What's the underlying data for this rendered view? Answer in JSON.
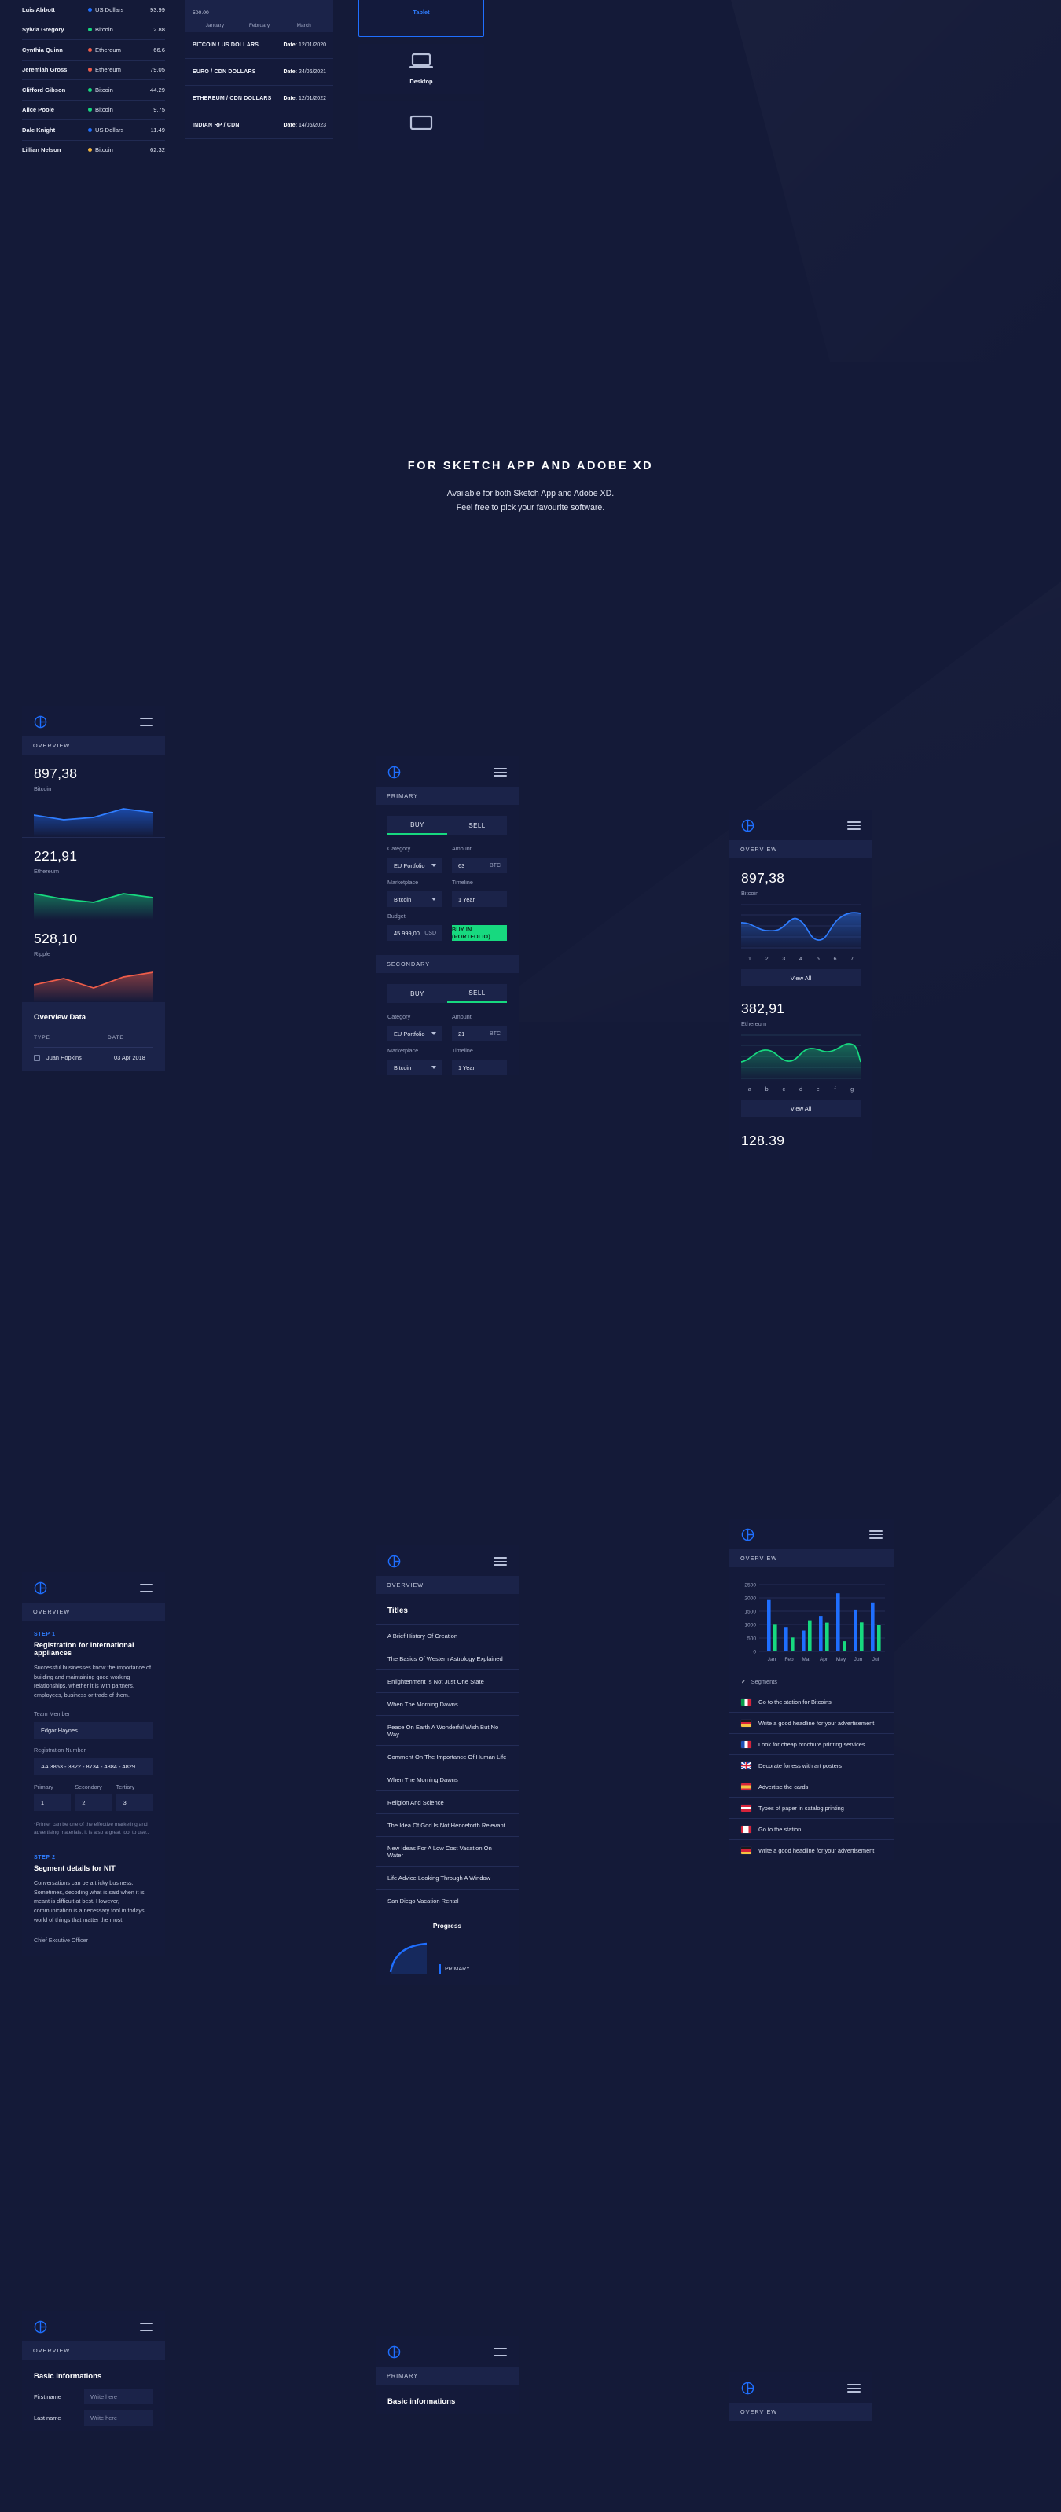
{
  "top": {
    "holders_table": {
      "rows": [
        {
          "name": "Luis Abbott",
          "currency": "US Dollars",
          "color": "#1f6fff",
          "value": "93.99"
        },
        {
          "name": "Sylvia Gregory",
          "currency": "Bitcoin",
          "color": "#17d97f",
          "value": "2.88"
        },
        {
          "name": "Cynthia Quinn",
          "currency": "Ethereum",
          "color": "#ef5d4a",
          "value": "66.6"
        },
        {
          "name": "Jeremiah Gross",
          "currency": "Ethereum",
          "color": "#ef5d4a",
          "value": "79.05"
        },
        {
          "name": "Clifford Gibson",
          "currency": "Bitcoin",
          "color": "#17d97f",
          "value": "44.29"
        },
        {
          "name": "Alice Poole",
          "currency": "Bitcoin",
          "color": "#17d97f",
          "value": "9.75"
        },
        {
          "name": "Dale Knight",
          "currency": "US Dollars",
          "color": "#1f6fff",
          "value": "11.49"
        },
        {
          "name": "Lillian Nelson",
          "currency": "Bitcoin",
          "color": "#f2b33d",
          "value": "62.32"
        }
      ]
    },
    "pairs_card": {
      "axis_value": "500.00",
      "months": [
        "January",
        "February",
        "March"
      ],
      "rows": [
        {
          "pair": "BITCOIN / US DOLLARS",
          "date_label": "Date:",
          "date": "12/01/2020"
        },
        {
          "pair": "EURO / CDN DOLLARS",
          "date_label": "Date:",
          "date": "24/06/2021"
        },
        {
          "pair": "ETHEREUM / CDN DOLLARS",
          "date_label": "Date:",
          "date": "12/01/2022"
        },
        {
          "pair": "INDIAN RP / CDN",
          "date_label": "Date:",
          "date": "14/06/2023"
        }
      ]
    },
    "devices": [
      {
        "label": "Tablet",
        "icon": "tablet-icon",
        "selected": true
      },
      {
        "label": "Desktop",
        "icon": "laptop-icon",
        "selected": false
      },
      {
        "label": "",
        "icon": "monitor-icon",
        "selected": false
      }
    ]
  },
  "hero": {
    "title": "FOR SKETCH APP AND ADOBE XD",
    "line1": "Available for both Sketch App and Adobe XD.",
    "line2": "Feel free to pick your favourite software."
  },
  "coin_widget": {
    "tab": "OVERVIEW",
    "coins": [
      {
        "value": "897,38",
        "name": "Bitcoin",
        "color": "#1f6fff"
      },
      {
        "value": "221,91",
        "name": "Ethereum",
        "color": "#17d97f"
      },
      {
        "value": "528,10",
        "name": "Ripple",
        "color": "#ef5d4a"
      }
    ],
    "overview_data": {
      "title": "Overview Data",
      "columns": [
        "TYPE",
        "DATE"
      ],
      "rows": [
        {
          "type": "Juan Hopkins",
          "date": "03 Apr 2018"
        }
      ]
    }
  },
  "trade_widget": {
    "tab_primary": "PRIMARY",
    "tab_secondary": "SECONDARY",
    "primary": {
      "tabs": [
        {
          "label": "BUY",
          "active": true
        },
        {
          "label": "SELL",
          "active": false
        }
      ],
      "category_label": "Category",
      "category_value": "EU Portfolio",
      "amount_label": "Amount",
      "amount_value": "63",
      "amount_unit": "BTC",
      "marketplace_label": "Marketplace",
      "marketplace_value": "Bitcoin",
      "timeline_label": "Timeline",
      "timeline_value": "1 Year",
      "budget_label": "Budget",
      "budget_value": "45.999,00",
      "budget_unit": "USD",
      "submit_label": "BUY IN (PORTFOLIO)"
    },
    "secondary": {
      "tabs": [
        {
          "label": "BUY",
          "active": false
        },
        {
          "label": "SELL",
          "active": true
        }
      ],
      "category_label": "Category",
      "category_value": "EU Portfolio",
      "amount_label": "Amount",
      "amount_value": "21",
      "amount_unit": "BTC",
      "marketplace_label": "Marketplace",
      "marketplace_value": "Bitcoin",
      "timeline_label": "Timeline",
      "timeline_value": "1 Year"
    }
  },
  "wave_widget": {
    "tab": "OVERVIEW",
    "blocks": [
      {
        "value": "897,38",
        "name": "Bitcoin",
        "color": "#2f7dff",
        "labels": [
          "1",
          "2",
          "3",
          "4",
          "5",
          "6",
          "7"
        ],
        "button": "View All"
      },
      {
        "value": "382,91",
        "name": "Ethereum",
        "color": "#17d97f",
        "labels": [
          "a",
          "b",
          "c",
          "d",
          "e",
          "f",
          "g"
        ],
        "button": "View All"
      }
    ],
    "trailing_value": "128.39"
  },
  "registration_widget": {
    "tab": "OVERVIEW",
    "step1": {
      "tag": "STEP 1",
      "title": "Registration for international appliances",
      "body": "Successful businesses know the importance of building and maintaining good working relationships, whether it is with partners, employees, business or trade of them.",
      "team_label": "Team Member",
      "team_value": "Edgar Haynes",
      "reg_label": "Registration Number",
      "reg_value": "AA 3853 - 3822 - 8734 - 4884 - 4829",
      "tiers": [
        {
          "label": "Primary",
          "value": "1"
        },
        {
          "label": "Secondary",
          "value": "2"
        },
        {
          "label": "Tertiary",
          "value": "3"
        }
      ],
      "note": "*Printer can be one of the effective marketing and advertising materials. It is also a great tool to use.."
    },
    "step2": {
      "tag": "STEP 2",
      "title": "Segment details for NIT",
      "body": "Conversations can be a tricky business. Sometimes, decoding what is said when it is meant is difficult at best. However, communication is a necessary tool in todays world of things that matter the most.",
      "signature": "Chief Excutive Officer"
    }
  },
  "titles_widget": {
    "tab": "OVERVIEW",
    "heading": "Titles",
    "items": [
      "A Brief History Of Creation",
      "The Basics Of Western Astrology Explained",
      "Enlightenment Is Not Just One State",
      "When The Morning Dawns",
      "Peace On Earth A Wonderful Wish But No Way",
      "Comment On The Importance Of Human Life",
      "When The Morning Dawns",
      "Religion And Science",
      "The Idea Of God Is Not Henceforth Relevant",
      "New Ideas For A Low Cost Vacation On Water",
      "Life Advice Looking Through A Window",
      "San Diego Vacation Rental"
    ],
    "progress_heading": "Progress",
    "progress_legend": "PRIMARY"
  },
  "segments_widget": {
    "tab": "OVERVIEW",
    "segments_label": "Segments",
    "items": [
      {
        "flag": "italy-flag",
        "text": "Go to the station for Bitcoins"
      },
      {
        "flag": "germany-flag",
        "text": "Write a good headline for your advertisement"
      },
      {
        "flag": "france-flag",
        "text": "Look for cheap brochure printing services"
      },
      {
        "flag": "uk-flag",
        "text": "Decorate forless with art posters"
      },
      {
        "flag": "spain-flag",
        "text": "Advertise the cards"
      },
      {
        "flag": "austria-flag",
        "text": "Types of paper in catalog printing"
      },
      {
        "flag": "canada-flag",
        "text": "Go to the station"
      },
      {
        "flag": "germany-flag",
        "text": "Write a good headline for your advertisement"
      }
    ]
  },
  "basic_info_left": {
    "tab": "OVERVIEW",
    "heading": "Basic informations",
    "fields": [
      {
        "label": "First name",
        "placeholder": "Write here"
      },
      {
        "label": "Last name",
        "placeholder": "Write here"
      }
    ]
  },
  "basic_info_mid": {
    "tab": "PRIMARY",
    "heading": "Basic informations"
  },
  "basic_info_right": {
    "tab": "OVERVIEW"
  },
  "chart_data": [
    {
      "type": "bar",
      "title": "",
      "categories": [
        "Jan",
        "Feb",
        "Mar",
        "Apr",
        "May",
        "Jun",
        "Jul"
      ],
      "series": [
        {
          "name": "Primary",
          "color": "#1f6fff",
          "values": [
            1920,
            905,
            780,
            1320,
            2170,
            1560,
            1830
          ]
        },
        {
          "name": "Secondary",
          "color": "#17d97f",
          "values": [
            1020,
            520,
            1160,
            1070,
            380,
            1080,
            980
          ]
        }
      ],
      "ylim": [
        0,
        2500
      ],
      "yticks": [
        0,
        500,
        1000,
        1500,
        2000,
        2500
      ],
      "xlabel": "",
      "ylabel": "",
      "grid": true,
      "legend": "none"
    },
    {
      "type": "area",
      "title": "Bitcoin",
      "label": "897,38",
      "x": [
        "1",
        "2",
        "3",
        "4",
        "5",
        "6",
        "7"
      ],
      "values": [
        62,
        46,
        48,
        72,
        28,
        30,
        84
      ],
      "color": "#2f7dff",
      "grid": true
    },
    {
      "type": "area",
      "title": "Ethereum",
      "label": "382,91",
      "x": [
        "a",
        "b",
        "c",
        "d",
        "e",
        "f",
        "g"
      ],
      "values": [
        40,
        62,
        44,
        70,
        58,
        76,
        40
      ],
      "color": "#17d97f",
      "grid": true
    },
    {
      "type": "area",
      "title": "Bitcoin",
      "label": "897,38",
      "x": [
        "1",
        "2",
        "3",
        "4",
        "5"
      ],
      "values": [
        52,
        44,
        60,
        50,
        72
      ],
      "color": "#1f6fff",
      "grid": false
    },
    {
      "type": "area",
      "title": "Ethereum",
      "label": "221,91",
      "x": [
        "1",
        "2",
        "3",
        "4",
        "5"
      ],
      "values": [
        66,
        54,
        48,
        70,
        62
      ],
      "color": "#17d97f",
      "grid": false
    },
    {
      "type": "area",
      "title": "Ripple",
      "label": "528,10",
      "x": [
        "1",
        "2",
        "3",
        "4",
        "5"
      ],
      "values": [
        44,
        60,
        38,
        66,
        74
      ],
      "color": "#ef5d4a",
      "grid": false
    }
  ]
}
